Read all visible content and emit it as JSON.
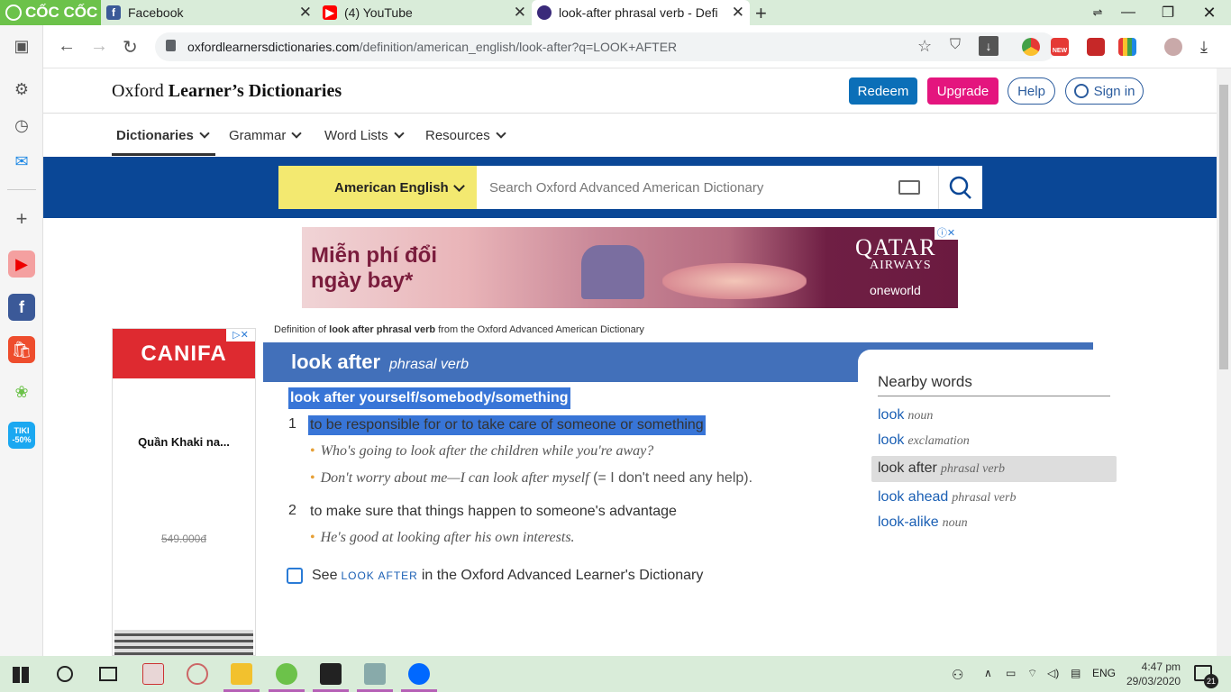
{
  "browser": {
    "brand": "CỐC CỐC",
    "tabs": [
      {
        "title": "Facebook"
      },
      {
        "title": "(4) YouTube"
      },
      {
        "title": "look-after phrasal verb - Defi"
      }
    ],
    "url_host": "oxfordlearnersdictionaries.com",
    "url_path": "/definition/american_english/look-after?q=LOOK+AFTER",
    "new_badge": "NEW"
  },
  "site": {
    "logo_plain": "Oxford ",
    "logo_bold": "Learner’s Dictionaries",
    "buttons": {
      "redeem": "Redeem",
      "upgrade": "Upgrade",
      "help": "Help",
      "signin": "Sign in"
    },
    "menu": [
      "Dictionaries",
      "Grammar",
      "Word Lists",
      "Resources"
    ],
    "dict_select": "American English",
    "search_placeholder": "Search Oxford Advanced American Dictionary"
  },
  "ads": {
    "banner_line1": "Miễn phí đổi",
    "banner_line2": "ngày bay*",
    "banner_brand": "QATAR",
    "banner_brand2": "AIRWAYS",
    "banner_alliance": "oneworld",
    "side_brand": "CANIFA",
    "side_product": "Quần Khaki na...",
    "side_price": "549.000đ"
  },
  "entry": {
    "crumb_prefix": "Definition of ",
    "crumb_word": "look after phrasal verb",
    "crumb_suffix": " from the Oxford Advanced American Dictionary",
    "headword": "look after",
    "pos": "phrasal verb",
    "idiom": "look after yourself/somebody/something",
    "senses": [
      {
        "num": "1",
        "def": "to be responsible for or to take care of someone or something",
        "examples": [
          {
            "text": "Who's going to look after the children while you're away?",
            "plain": ""
          },
          {
            "text": "Don't worry about me—I can look after myself",
            "plain": " (= I don't need any help)."
          }
        ]
      },
      {
        "num": "2",
        "def": "to make sure that things happen to someone's advantage",
        "examples": [
          {
            "text": "He's good at looking after his own interests.",
            "plain": ""
          }
        ]
      }
    ],
    "see_prefix": "See",
    "see_link": "LOOK AFTER",
    "see_suffix": "in the Oxford Advanced Learner's Dictionary"
  },
  "nearby": {
    "heading": "Nearby words",
    "items": [
      {
        "word": "look",
        "pos": "noun"
      },
      {
        "word": "look",
        "pos": "exclamation"
      },
      {
        "word": "look after",
        "pos": "phrasal verb"
      },
      {
        "word": "look ahead",
        "pos": "phrasal verb"
      },
      {
        "word": "look-alike",
        "pos": "noun"
      }
    ]
  },
  "taskbar": {
    "lang": "ENG",
    "time": "4:47 pm",
    "date": "29/03/2020",
    "notif_count": "21",
    "tiki_label": "TIKI",
    "tiki_discount": "-50%"
  },
  "colors": {
    "oxford_blue": "#0a4796",
    "header_blue": "#4270ba",
    "redeem": "#0b6fb8",
    "upgrade": "#e4157e",
    "dict_yellow": "#f3e970",
    "selection": "#3875d7",
    "link": "#1a5fb4"
  }
}
